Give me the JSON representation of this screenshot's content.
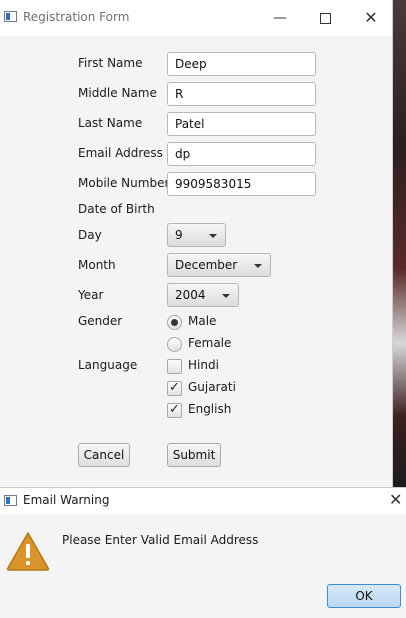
{
  "main_window": {
    "title": "Registration Form",
    "controls": {
      "minimize": "—",
      "close": "✕"
    }
  },
  "form": {
    "first_name": {
      "label": "First Name",
      "value": "Deep"
    },
    "middle_name": {
      "label": "Middle Name",
      "value": "R"
    },
    "last_name": {
      "label": "Last Name",
      "value": "Patel"
    },
    "email": {
      "label": "Email Address",
      "value": "dp"
    },
    "mobile": {
      "label": "Mobile Number",
      "value": "9909583015"
    },
    "dob_label": "Date of Birth",
    "day": {
      "label": "Day",
      "value": "9"
    },
    "month": {
      "label": "Month",
      "value": "December"
    },
    "year": {
      "label": "Year",
      "value": "2004"
    },
    "gender": {
      "label": "Gender",
      "options": [
        {
          "label": "Male",
          "selected": true
        },
        {
          "label": "Female",
          "selected": false
        }
      ]
    },
    "language": {
      "label": "Language",
      "options": [
        {
          "label": "Hindi",
          "checked": false
        },
        {
          "label": "Gujarati",
          "checked": true
        },
        {
          "label": "English",
          "checked": true
        }
      ]
    },
    "cancel_label": "Cancel",
    "submit_label": "Submit"
  },
  "dialog": {
    "title": "Email Warning",
    "close": "✕",
    "message": "Please Enter Valid Email Address",
    "ok_label": "OK",
    "icon": "warning-icon",
    "warning_color": "#d9952a"
  }
}
